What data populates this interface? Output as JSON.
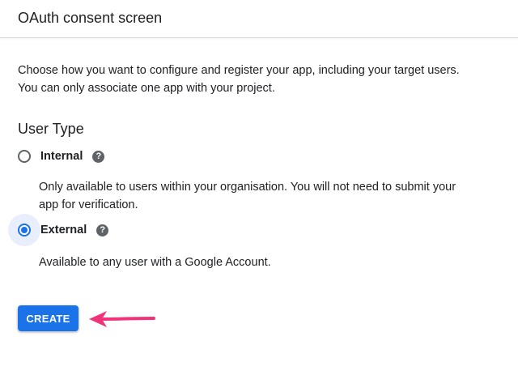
{
  "header": {
    "title": "OAuth consent screen"
  },
  "intro": {
    "text": "Choose how you want to configure and register your app, including your target users. You can only associate one app with your project."
  },
  "user_type": {
    "heading": "User Type",
    "options": [
      {
        "label": "Internal",
        "selected": false,
        "help_icon": "help-icon",
        "description": "Only available to users within your organisation. You will not need to submit your app for verification."
      },
      {
        "label": "External",
        "selected": true,
        "help_icon": "help-icon",
        "description": "Available to any user with a Google Account."
      }
    ]
  },
  "actions": {
    "create_label": "CREATE"
  },
  "colors": {
    "accent": "#1a73e8",
    "arrow": "#f0337a",
    "text": "#202124",
    "icon_gray": "#5f6368"
  }
}
